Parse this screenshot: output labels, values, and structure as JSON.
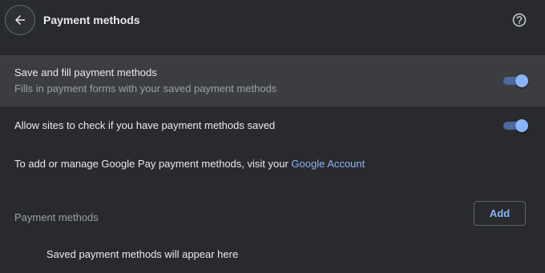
{
  "header": {
    "title": "Payment methods",
    "back_icon": "arrow-left-icon",
    "help_icon": "help-circle-icon"
  },
  "settings": {
    "save_fill": {
      "title": "Save and fill payment methods",
      "subtitle": "Fills in payment forms with your saved payment methods",
      "enabled": true
    },
    "allow_check": {
      "title": "Allow sites to check if you have payment methods saved",
      "enabled": true
    },
    "gpay": {
      "text": "To add or manage Google Pay payment methods, visit your ",
      "link_label": "Google Account"
    }
  },
  "payment_methods": {
    "section_title": "Payment methods",
    "add_label": "Add",
    "empty_message": "Saved payment methods will appear here"
  },
  "colors": {
    "background": "#292a2d",
    "highlight_row": "#3c3d40",
    "accent": "#8ab4f8",
    "toggle_track": "#4c6aa0",
    "text_primary": "#e8eaed",
    "text_secondary": "#9aa0a6"
  }
}
